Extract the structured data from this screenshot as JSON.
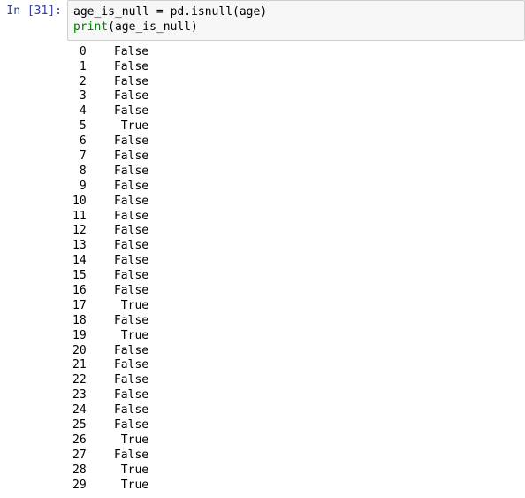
{
  "input": {
    "prompt": "In  [31]:",
    "line1_var": "age_is_null",
    "line1_eq": " = ",
    "line1_mod": "pd",
    "line1_dot": ".",
    "line1_fn": "isnull",
    "line1_arg": "(age)",
    "line2_fn": "print",
    "line2_arg": "(age_is_null)"
  },
  "output": {
    "rows": [
      {
        "idx": "0",
        "val": "False"
      },
      {
        "idx": "1",
        "val": "False"
      },
      {
        "idx": "2",
        "val": "False"
      },
      {
        "idx": "3",
        "val": "False"
      },
      {
        "idx": "4",
        "val": "False"
      },
      {
        "idx": "5",
        "val": "True"
      },
      {
        "idx": "6",
        "val": "False"
      },
      {
        "idx": "7",
        "val": "False"
      },
      {
        "idx": "8",
        "val": "False"
      },
      {
        "idx": "9",
        "val": "False"
      },
      {
        "idx": "10",
        "val": "False"
      },
      {
        "idx": "11",
        "val": "False"
      },
      {
        "idx": "12",
        "val": "False"
      },
      {
        "idx": "13",
        "val": "False"
      },
      {
        "idx": "14",
        "val": "False"
      },
      {
        "idx": "15",
        "val": "False"
      },
      {
        "idx": "16",
        "val": "False"
      },
      {
        "idx": "17",
        "val": "True"
      },
      {
        "idx": "18",
        "val": "False"
      },
      {
        "idx": "19",
        "val": "True"
      },
      {
        "idx": "20",
        "val": "False"
      },
      {
        "idx": "21",
        "val": "False"
      },
      {
        "idx": "22",
        "val": "False"
      },
      {
        "idx": "23",
        "val": "False"
      },
      {
        "idx": "24",
        "val": "False"
      },
      {
        "idx": "25",
        "val": "False"
      },
      {
        "idx": "26",
        "val": "True"
      },
      {
        "idx": "27",
        "val": "False"
      },
      {
        "idx": "28",
        "val": "True"
      },
      {
        "idx": "29",
        "val": "True"
      }
    ]
  }
}
